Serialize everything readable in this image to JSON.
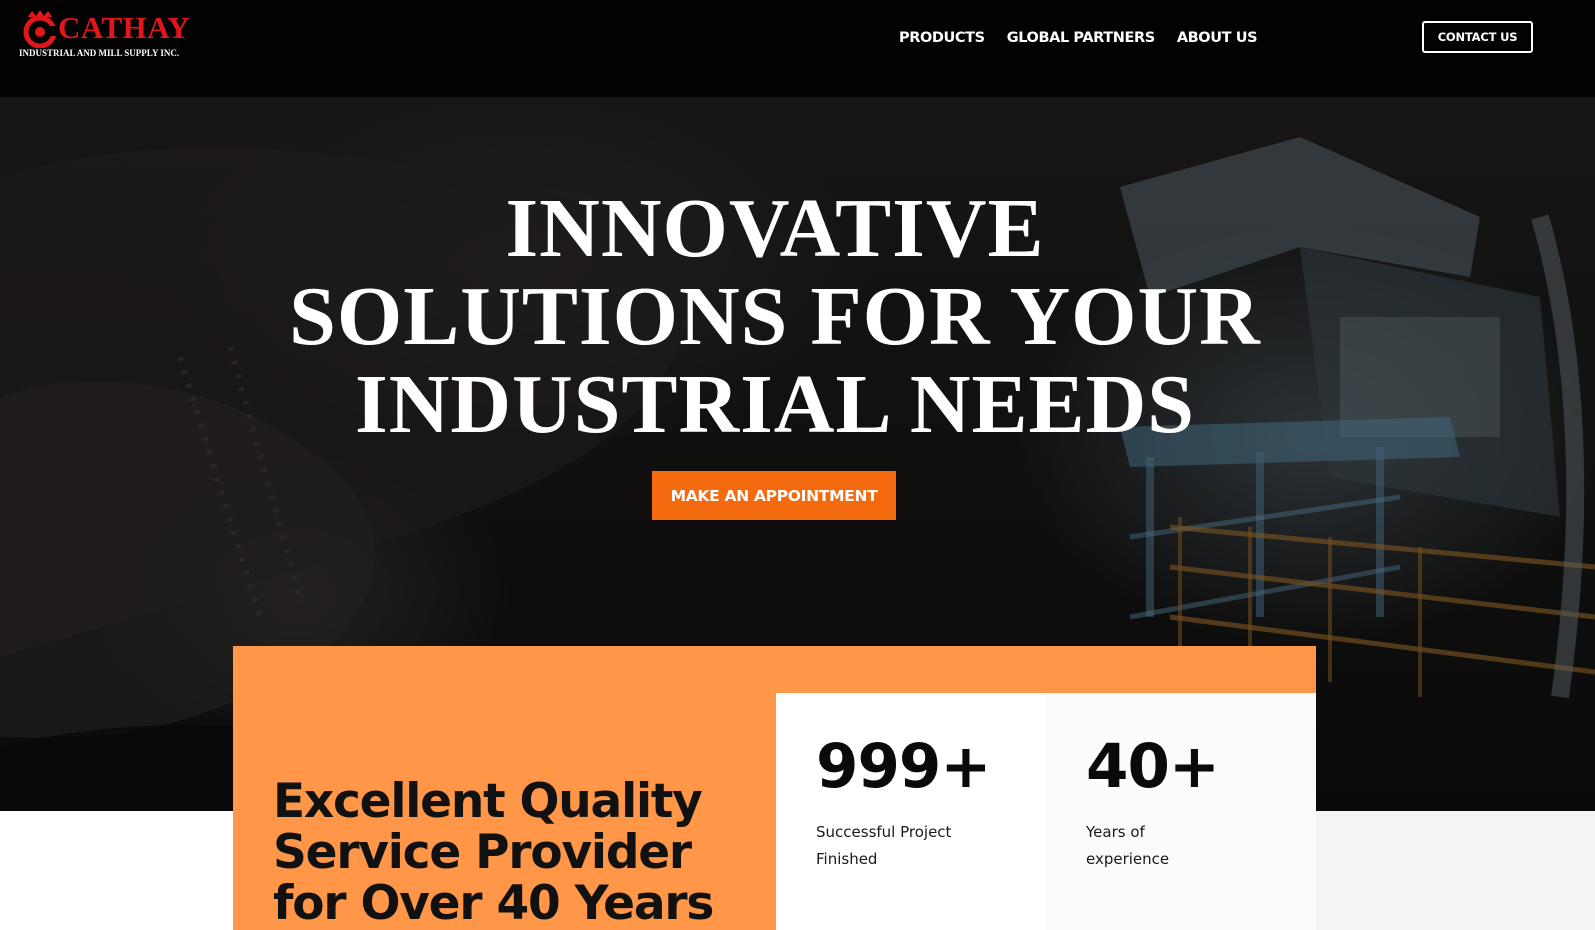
{
  "brand": {
    "name": "CATHAY",
    "tagline": "INDUSTRIAL AND MILL SUPPLY INC.",
    "primary_color": "#e3161b"
  },
  "nav": {
    "items": [
      {
        "label": "PRODUCTS"
      },
      {
        "label": "GLOBAL PARTNERS"
      },
      {
        "label": "ABOUT US"
      }
    ],
    "contact_label": "CONTACT US"
  },
  "hero": {
    "title_lines": [
      "INNOVATIVE",
      "SOLUTIONS FOR YOUR",
      "INDUSTRIAL NEEDS"
    ],
    "cta_label": "MAKE AN APPOINTMENT",
    "accent_color": "#f46a0e"
  },
  "quality": {
    "heading_lines": [
      "Excellent Quality",
      "Service Provider",
      "for Over 40 Years"
    ],
    "panel_color": "#ff9648"
  },
  "stats": [
    {
      "value": "999+",
      "label_lines": [
        "Successful Project",
        "Finished"
      ]
    },
    {
      "value": "40+",
      "label_lines": [
        "Years of",
        "experience"
      ]
    }
  ]
}
